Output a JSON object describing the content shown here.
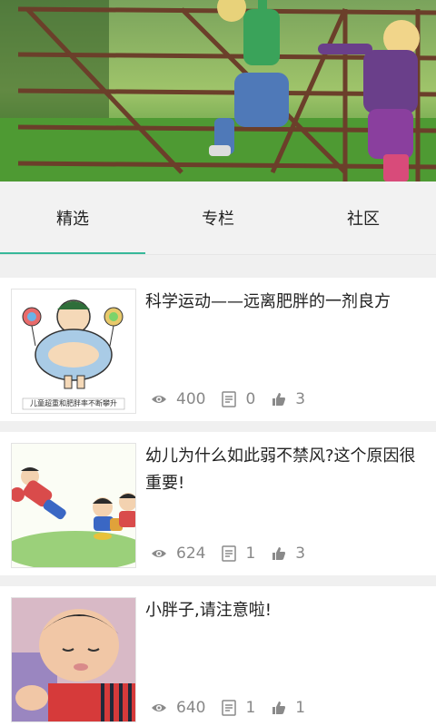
{
  "tabs": [
    {
      "label": "精选",
      "active": true
    },
    {
      "label": "专栏",
      "active": false
    },
    {
      "label": "社区",
      "active": false
    }
  ],
  "accent_color": "#37b89a",
  "articles": [
    {
      "title": "科学运动——远离肥胖的一剂良方",
      "thumb_caption": "儿童超重和肥胖率不断攀升",
      "views": "400",
      "comments": "0",
      "likes": "3"
    },
    {
      "title": "幼儿为什么如此弱不禁风?这个原因很重要!",
      "views": "624",
      "comments": "1",
      "likes": "3"
    },
    {
      "title": "小胖子,请注意啦!",
      "views": "640",
      "comments": "1",
      "likes": "1"
    }
  ]
}
